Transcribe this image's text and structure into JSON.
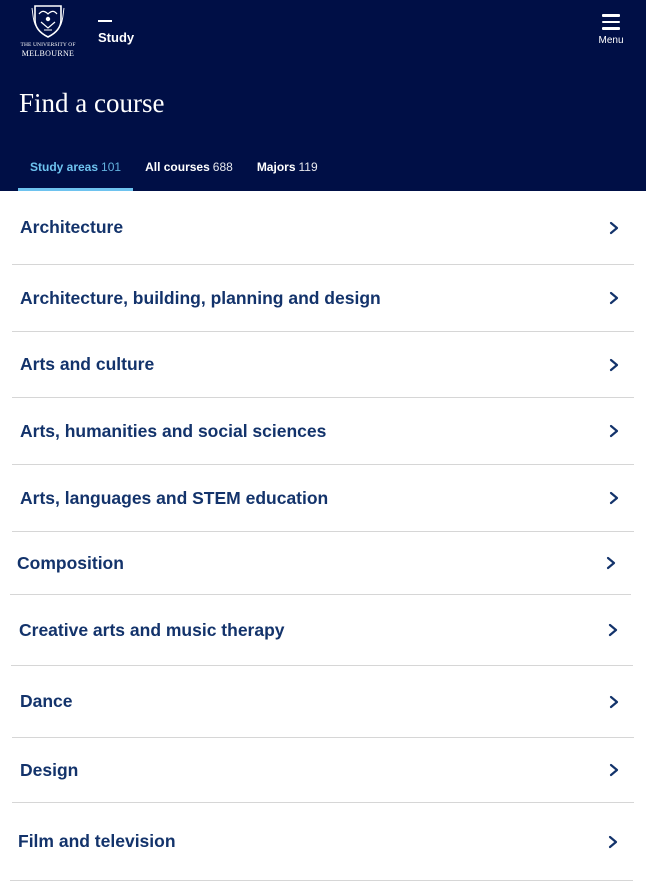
{
  "header": {
    "logo_line1": "THE UNIVERSITY OF",
    "logo_line2": "MELBOURNE",
    "section_label": "Study",
    "menu_label": "Menu",
    "page_title": "Find a course"
  },
  "tabs": [
    {
      "label": "Study areas",
      "count": "101",
      "active": true
    },
    {
      "label": "All courses",
      "count": "688",
      "active": false
    },
    {
      "label": "Majors",
      "count": "119",
      "active": false
    }
  ],
  "study_areas": [
    {
      "label": "Architecture"
    },
    {
      "label": "Architecture, building, planning and design"
    },
    {
      "label": "Arts and culture"
    },
    {
      "label": "Arts, humanities and social sciences"
    },
    {
      "label": "Arts, languages and STEM education"
    },
    {
      "label": "Composition"
    },
    {
      "label": "Creative arts and music therapy"
    },
    {
      "label": "Dance"
    },
    {
      "label": "Design"
    },
    {
      "label": "Film and television"
    }
  ],
  "colors": {
    "header_bg": "#000f46",
    "active_tab": "#6ec3ef",
    "item_text": "#13336b",
    "divider": "#d6d6d6"
  },
  "icons": {
    "logo": "university-crest-icon",
    "menu": "hamburger-menu-icon",
    "row": "chevron-right-icon"
  }
}
